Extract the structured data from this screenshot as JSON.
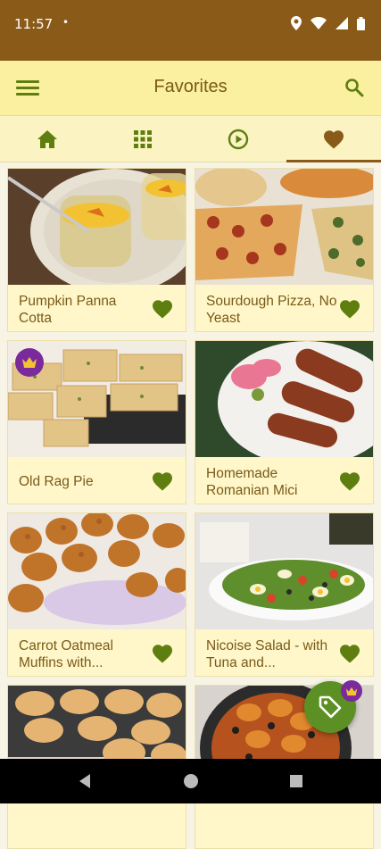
{
  "status": {
    "time": "11:57",
    "dot": "•"
  },
  "appbar": {
    "title": "Favorites"
  },
  "tabs": [
    {
      "name": "home",
      "active": false
    },
    {
      "name": "grid",
      "active": false
    },
    {
      "name": "video",
      "active": false
    },
    {
      "name": "favorites",
      "active": true
    }
  ],
  "recipes": [
    {
      "title": "Pumpkin Panna Cotta",
      "premium": false
    },
    {
      "title": "Sourdough Pizza, No Yeast",
      "premium": false
    },
    {
      "title": "Old Rag Pie",
      "premium": true
    },
    {
      "title": "Homemade Romanian Mici",
      "premium": false
    },
    {
      "title": "Carrot Oatmeal Muffins with...",
      "premium": false
    },
    {
      "title": "Nicoise Salad - with Tuna and...",
      "premium": false
    },
    {
      "title": "",
      "premium": false
    },
    {
      "title": "",
      "premium": false
    }
  ],
  "colors": {
    "status_bar": "#8a5a18",
    "app_bar": "#fbf0a0",
    "accent": "#5e7f10",
    "title": "#7a5a18",
    "premium": "#7a2a9a"
  }
}
